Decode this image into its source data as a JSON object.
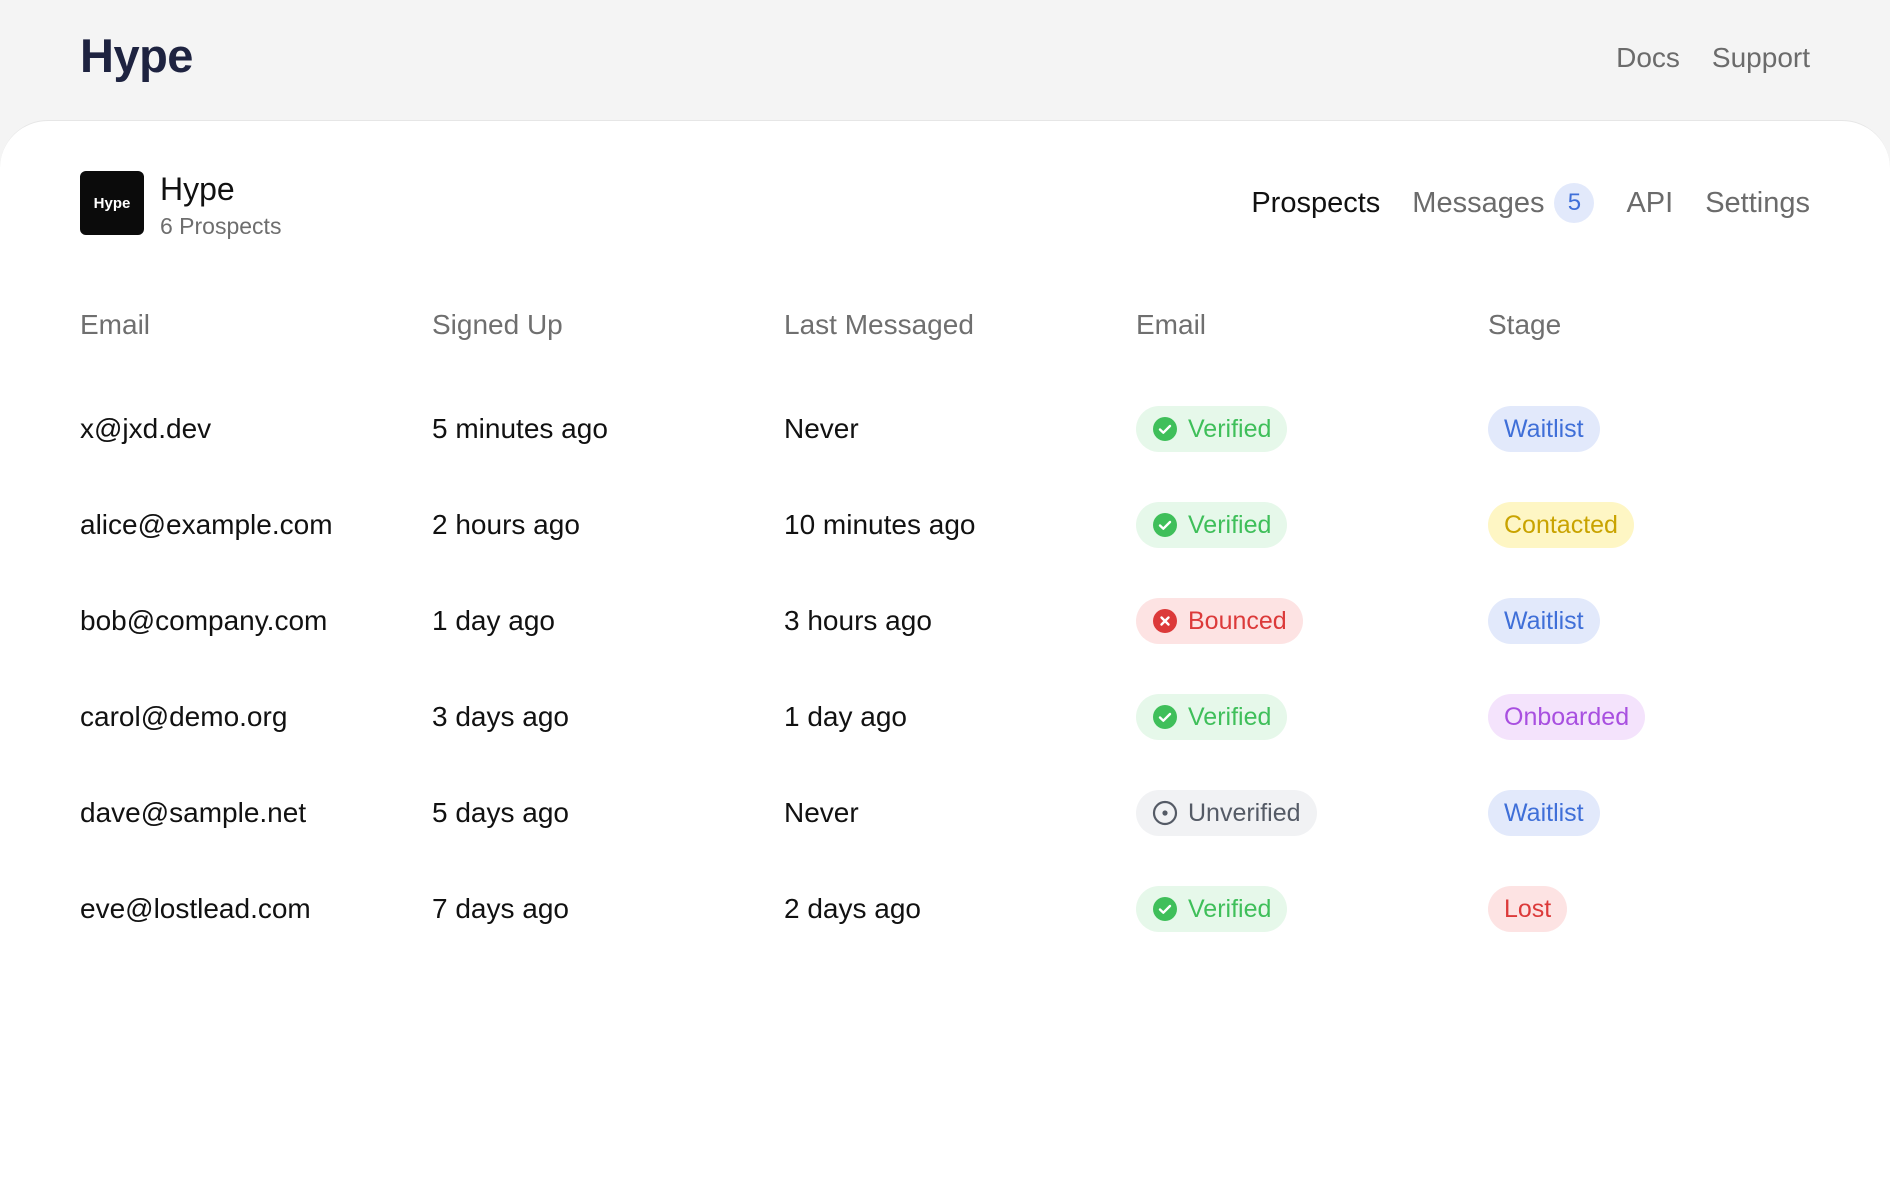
{
  "header": {
    "brand": "Hype",
    "links": [
      "Docs",
      "Support"
    ]
  },
  "project": {
    "logo_text": "Hype",
    "name": "Hype",
    "subtitle": "6 Prospects"
  },
  "tabs": [
    {
      "label": "Prospects",
      "active": true
    },
    {
      "label": "Messages",
      "badge": "5"
    },
    {
      "label": "API"
    },
    {
      "label": "Settings"
    }
  ],
  "table": {
    "columns": [
      "Email",
      "Signed Up",
      "Last Messaged",
      "Email",
      "Stage"
    ],
    "rows": [
      {
        "email": "x@jxd.dev",
        "signed_up": "5 minutes ago",
        "last_messaged": "Never",
        "email_status": "Verified",
        "stage": "Waitlist"
      },
      {
        "email": "alice@example.com",
        "signed_up": "2 hours ago",
        "last_messaged": "10 minutes ago",
        "email_status": "Verified",
        "stage": "Contacted"
      },
      {
        "email": "bob@company.com",
        "signed_up": "1 day ago",
        "last_messaged": "3 hours ago",
        "email_status": "Bounced",
        "stage": "Waitlist"
      },
      {
        "email": "carol@demo.org",
        "signed_up": "3 days ago",
        "last_messaged": "1 day ago",
        "email_status": "Verified",
        "stage": "Onboarded"
      },
      {
        "email": "dave@sample.net",
        "signed_up": "5 days ago",
        "last_messaged": "Never",
        "email_status": "Unverified",
        "stage": "Waitlist"
      },
      {
        "email": "eve@lostlead.com",
        "signed_up": "7 days ago",
        "last_messaged": "2 days ago",
        "email_status": "Verified",
        "stage": "Lost"
      }
    ]
  },
  "colors": {
    "verified": "#3fbf5a",
    "bounced": "#dc3a3a",
    "unverified": "#555b66",
    "waitlist": "#3f6fd8",
    "contacted": "#c9a300",
    "onboarded": "#a84fe0",
    "lost": "#dc3a3a"
  },
  "icons": {
    "Verified": "check-circle-icon",
    "Bounced": "x-circle-icon",
    "Unverified": "dot-circle-icon"
  }
}
